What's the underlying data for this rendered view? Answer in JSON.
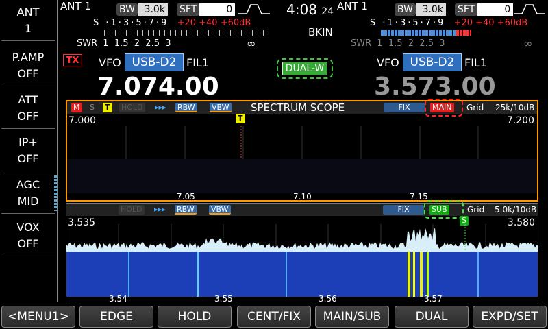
{
  "side": [
    {
      "label": "ANT",
      "value": "1"
    },
    {
      "label": "P.AMP",
      "value": "OFF"
    },
    {
      "label": "ATT",
      "value": "OFF"
    },
    {
      "label": "IP+",
      "value": "OFF"
    },
    {
      "label": "AGC",
      "value": "MID"
    },
    {
      "label": "VOX",
      "value": "OFF"
    }
  ],
  "main": {
    "ant": "ANT 1",
    "bw_label": "BW",
    "bw": "3.0k",
    "sft_label": "SFT",
    "sft": "0",
    "s_label": "S",
    "s_scale": "·1·3·5·7·9",
    "s_over": "+20 +40 +60dB",
    "swr_label": "SWR",
    "swr_scale": "1  1.5  2  2.5  3",
    "inf": "∞",
    "vfo": "VFO",
    "mode": "USB-D2",
    "fil": "FIL1",
    "freq": "7.074.00",
    "tx": "TX"
  },
  "sub": {
    "ant": "ANT 1",
    "bw_label": "BW",
    "bw": "3.0k",
    "sft_label": "SFT",
    "sft": "0",
    "s_label": "S",
    "s_scale": "·1·3·5·7·9",
    "s_over": "+20 +40 +60dB",
    "swr_label": "SWR",
    "swr_scale": "1  1.5  2  2.5  3",
    "inf": "∞",
    "vfo": "VFO",
    "mode": "USB-D2",
    "fil": "FIL1",
    "freq": "3.573.00"
  },
  "clock": {
    "time": "4:08",
    "sec": "24"
  },
  "bkin": "BKIN",
  "dual_w": "DUAL-W",
  "scope_main": {
    "m": "M",
    "s": "S",
    "t": "T",
    "hold": "HOLD",
    "arrows": "▸▸▸",
    "rbw": "RBW",
    "vbw": "VBW",
    "title": "SPECTRUM SCOPE",
    "fix": "FIX",
    "band": "MAIN",
    "grid": "Grid",
    "span": "25k/10dB",
    "left_edge": "7.000",
    "right_edge": "7.200",
    "marker": "T",
    "ticks": [
      "7.05",
      "7.10",
      "7.15"
    ]
  },
  "scope_sub": {
    "hold": "HOLD",
    "arrows": "▸▸▸",
    "rbw": "RBW",
    "vbw": "VBW",
    "fix": "FIX",
    "band": "SUB",
    "grid": "Grid",
    "span": "5.0k/10dB",
    "left_edge": "3.535",
    "right_edge": "3.580",
    "marker": "S",
    "ticks": [
      "3.54",
      "3.55",
      "3.56",
      "3.57"
    ]
  },
  "menu": [
    "<MENU1>",
    "EDGE",
    "HOLD",
    "CENT/FIX",
    "MAIN/SUB",
    "DUAL",
    "EXPD/SET"
  ],
  "colors": {
    "accent": "#f90",
    "mode": "#2f6fc0",
    "tx": "#f33",
    "sub_freq": "#999"
  }
}
